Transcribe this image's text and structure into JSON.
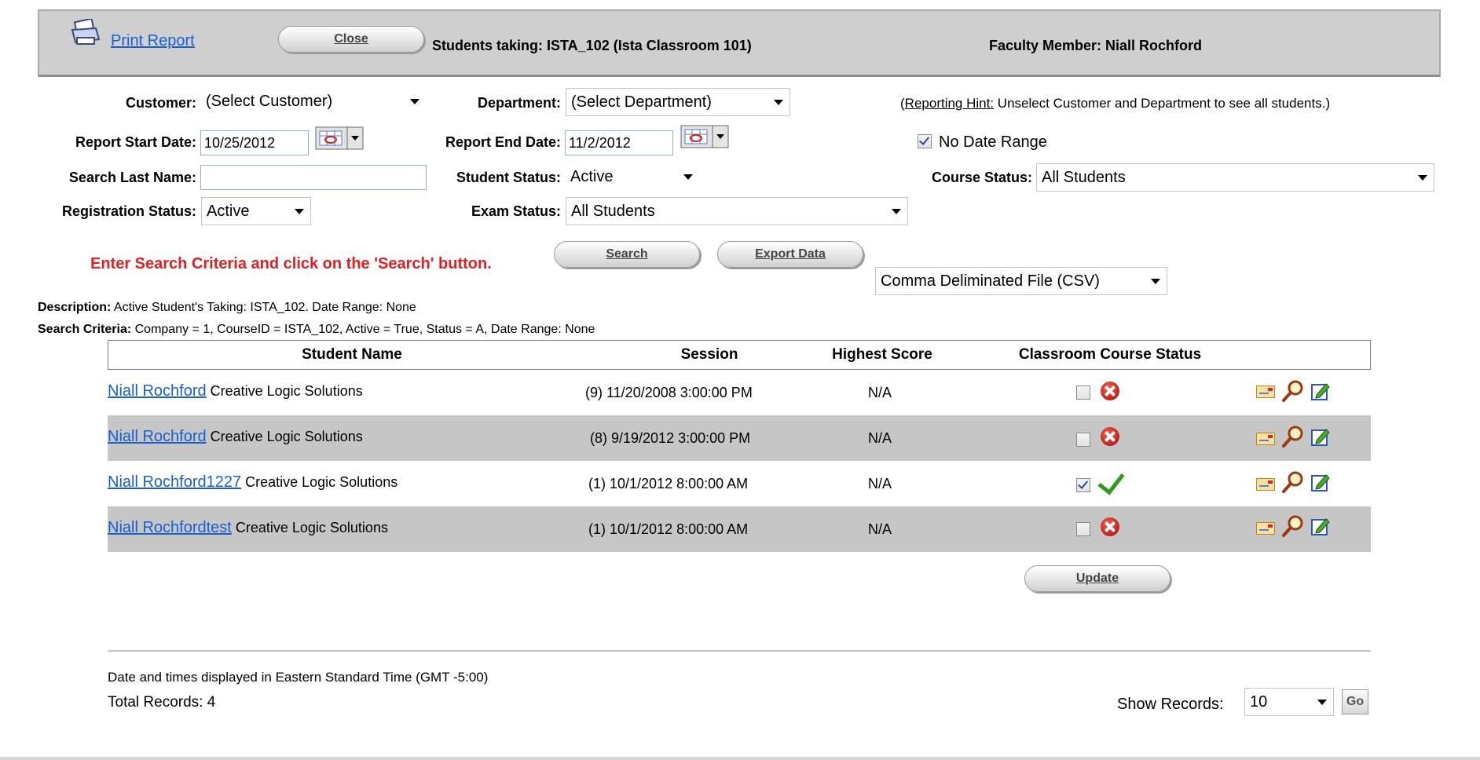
{
  "header": {
    "print_report": "Print Report",
    "close_label": "Close",
    "students_taking": "Students taking: ISTA_102 (Ista Classroom 101)",
    "faculty_member": "Faculty Member: Niall Rochford"
  },
  "filters": {
    "customer_label": "Customer:",
    "customer_value": "(Select Customer)",
    "department_label": "Department:",
    "department_value": "(Select Department)",
    "hint_prefix": "(",
    "hint_link": "Reporting Hint:",
    "hint_text": " Unselect Customer and Department to see all students.)",
    "start_date_label": "Report Start Date:",
    "start_date_value": "10/25/2012",
    "end_date_label": "Report End Date:",
    "end_date_value": "11/2/2012",
    "no_date_range_label": "No Date Range",
    "no_date_range_checked": true,
    "last_name_label": "Search Last Name:",
    "last_name_value": "",
    "student_status_label": "Student Status:",
    "student_status_value": "Active",
    "course_status_label": "Course Status:",
    "course_status_value": "All Students",
    "registration_status_label": "Registration Status:",
    "registration_status_value": "Active",
    "exam_status_label": "Exam Status:",
    "exam_status_value": "All Students"
  },
  "actions": {
    "instruction": "Enter Search Criteria and click on the 'Search' button.",
    "search_label": "Search",
    "export_label": "Export Data",
    "export_format": "Comma Deliminated File (CSV)"
  },
  "summary": {
    "description_label": "Description:",
    "description_text": " Active Student's Taking: ISTA_102. Date Range: None",
    "criteria_label": "Search Criteria:",
    "criteria_text": " Company = 1, CourseID = ISTA_102, Active = True, Status = A, Date Range: None"
  },
  "table": {
    "headers": [
      "Student Name",
      "Session",
      "Highest Score",
      "Classroom Course Status"
    ],
    "rows": [
      {
        "name": "Niall Rochford",
        "company": " Creative Logic Solutions",
        "session": "(9) 11/20/2008 3:00:00 PM",
        "score": "N/A",
        "checked": false
      },
      {
        "name": "Niall Rochford",
        "company": " Creative Logic Solutions",
        "session": "(8) 9/19/2012 3:00:00 PM",
        "score": "N/A",
        "checked": false
      },
      {
        "name": "Niall Rochford1227",
        "company": " Creative Logic Solutions",
        "session": "(1) 10/1/2012 8:00:00 AM",
        "score": "N/A",
        "checked": true
      },
      {
        "name": "Niall Rochfordtest",
        "company": " Creative Logic Solutions",
        "session": "(1) 10/1/2012 8:00:00 AM",
        "score": "N/A",
        "checked": false
      }
    ],
    "update_label": "Update"
  },
  "footer": {
    "timezone_note": "Date and times displayed in Eastern Standard Time (GMT -5:00)",
    "total_records": "Total Records: 4",
    "show_records_label": "Show Records:",
    "show_records_value": "10",
    "go_label": "Go"
  },
  "colors": {
    "link": "#1a5fd0",
    "instruction": "#e02020",
    "header_bg": "#cfcfcf",
    "alt_row_bg": "#c6c6c6",
    "check_green": "#2f9a1c",
    "x_red": "#c0201a"
  }
}
